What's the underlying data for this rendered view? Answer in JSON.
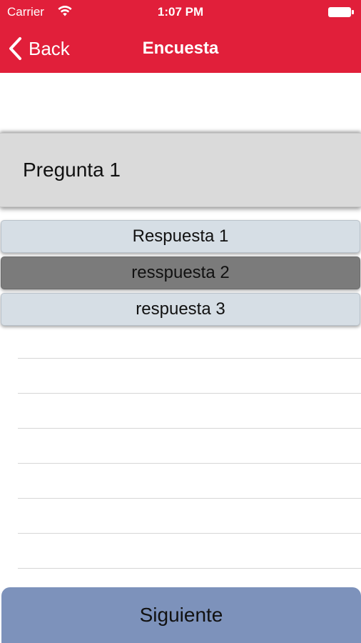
{
  "status_bar": {
    "carrier": "Carrier",
    "time": "1:07 PM",
    "wifi_icon": "wifi-icon",
    "battery_icon": "battery-full-icon"
  },
  "nav": {
    "back_label": "Back",
    "back_icon": "chevron-left-icon",
    "title": "Encuesta"
  },
  "question": {
    "text": "Pregunta 1"
  },
  "answers": [
    {
      "label": "Respuesta 1",
      "selected": false
    },
    {
      "label": "resspuesta 2",
      "selected": true
    },
    {
      "label": "respuesta 3",
      "selected": false
    }
  ],
  "footer": {
    "next_label": "Siguiente"
  },
  "colors": {
    "header": "#e11f3a",
    "question_bg": "#dadada",
    "answer_bg": "#d6dee5",
    "answer_selected_bg": "#7b7b7b",
    "next_button_bg": "#7d92bb"
  }
}
